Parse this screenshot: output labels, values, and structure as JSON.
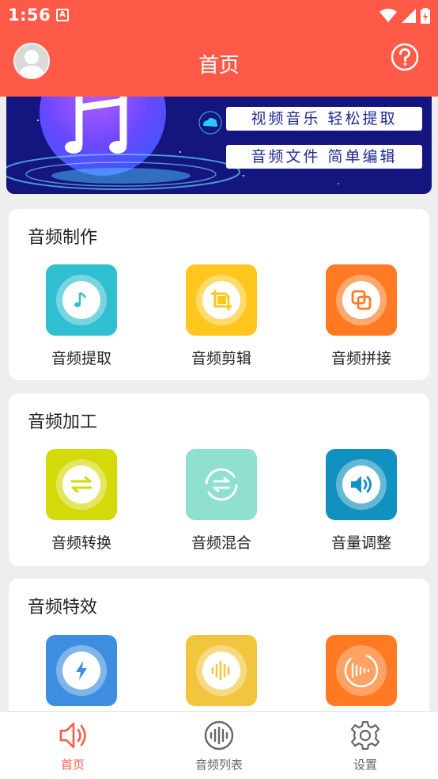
{
  "statusbar": {
    "time": "1:56",
    "notif_glyph": "A"
  },
  "header": {
    "title": "首页"
  },
  "banner": {
    "line1": "视频音乐  轻松提取",
    "line2": "音频文件  简单编辑"
  },
  "sections": [
    {
      "title": "音频制作",
      "tools": [
        {
          "label": "音频提取",
          "color": "#2fbfd0",
          "icon": "music-note-icon"
        },
        {
          "label": "音频剪辑",
          "color": "#ffc61e",
          "icon": "crop-icon"
        },
        {
          "label": "音频拼接",
          "color": "#ff7a22",
          "icon": "merge-icon"
        }
      ]
    },
    {
      "title": "音频加工",
      "tools": [
        {
          "label": "音频转换",
          "color": "#d4d90a",
          "icon": "convert-arrows-icon"
        },
        {
          "label": "音频混合",
          "color": "#8fe0cf",
          "icon": "mix-icon"
        },
        {
          "label": "音量调整",
          "color": "#1191bf",
          "icon": "volume-icon"
        }
      ]
    },
    {
      "title": "音频特效",
      "tools": [
        {
          "label": "",
          "color": "#3d8ee0",
          "icon": "lightning-icon"
        },
        {
          "label": "",
          "color": "#f2c53e",
          "icon": "waveform-icon"
        },
        {
          "label": "",
          "color": "#ff7a22",
          "icon": "fade-icon"
        }
      ]
    }
  ],
  "nav": [
    {
      "label": "首页",
      "active": true,
      "icon": "speaker-icon"
    },
    {
      "label": "音频列表",
      "active": false,
      "icon": "waveform-circle-icon"
    },
    {
      "label": "设置",
      "active": false,
      "icon": "gear-icon"
    }
  ],
  "colors": {
    "primary": "#ff5a48",
    "nav_inactive": "#666666"
  }
}
